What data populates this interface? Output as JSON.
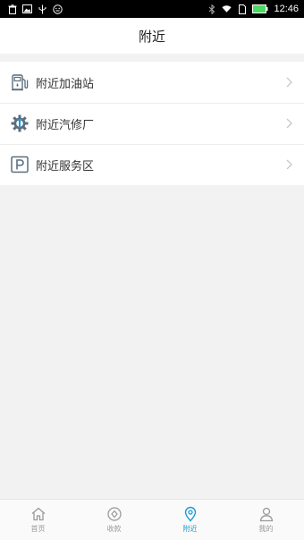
{
  "status_bar": {
    "time": "12:46",
    "left_icons": [
      "trash-icon",
      "image-icon",
      "usb-icon",
      "emoji-icon"
    ],
    "right_icons": [
      "bluetooth-icon",
      "wifi-icon",
      "sim-icon",
      "battery-icon"
    ]
  },
  "header": {
    "title": "附近"
  },
  "menu": {
    "items": [
      {
        "label": "附近加油站",
        "icon": "gas-station-icon"
      },
      {
        "label": "附近汽修厂",
        "icon": "repair-gear-icon"
      },
      {
        "label": "附近服务区",
        "icon": "parking-icon"
      }
    ]
  },
  "tab_bar": {
    "tabs": [
      {
        "label": "首页",
        "icon": "home-icon",
        "active": false
      },
      {
        "label": "收款",
        "icon": "collect-icon",
        "active": false
      },
      {
        "label": "附近",
        "icon": "location-pin-icon",
        "active": true
      },
      {
        "label": "我的",
        "icon": "user-icon",
        "active": false
      }
    ]
  },
  "colors": {
    "accent": "#1e9bd7",
    "inactive": "#999999",
    "icon_gray": "#5a6e7d",
    "background": "#f2f2f2",
    "battery": "#4cd964"
  }
}
